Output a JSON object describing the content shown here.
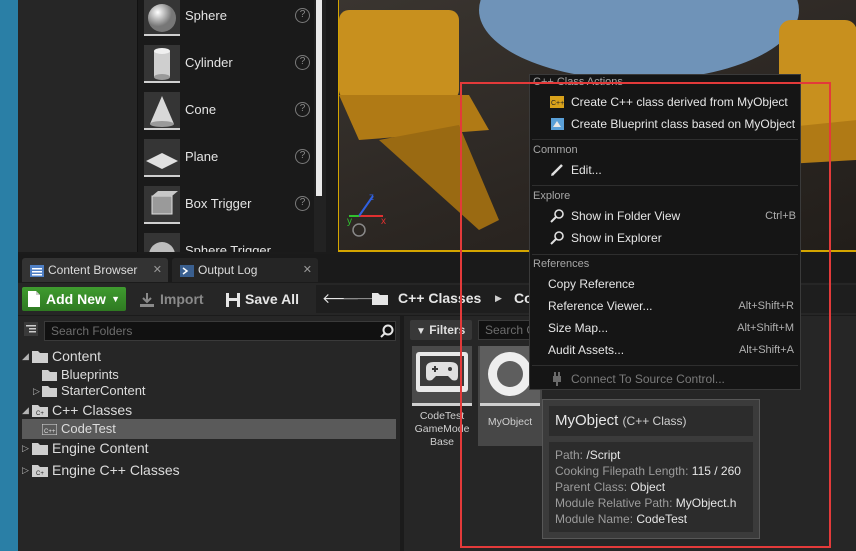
{
  "place_actors": {
    "items": [
      {
        "label": "Sphere",
        "icon": "sphere-icon"
      },
      {
        "label": "Cylinder",
        "icon": "cylinder-icon"
      },
      {
        "label": "Cone",
        "icon": "cone-icon"
      },
      {
        "label": "Plane",
        "icon": "plane-icon"
      },
      {
        "label": "Box Trigger",
        "icon": "box-trigger-icon"
      },
      {
        "label": "Sphere Trigger",
        "icon": "sphere-trigger-icon"
      }
    ],
    "help_glyph": "?"
  },
  "tabs": [
    {
      "label": "Content Browser",
      "close": "✕"
    },
    {
      "label": "Output Log",
      "close": "✕"
    }
  ],
  "toolbar": {
    "add_new": "Add New",
    "import": "Import",
    "save_all": "Save All",
    "breadcrumb": [
      "C++ Classes",
      "Co"
    ]
  },
  "tree": {
    "search_placeholder": "Search Folders",
    "items": [
      {
        "label": "Content"
      },
      {
        "label": "Blueprints"
      },
      {
        "label": "StarterContent"
      },
      {
        "label": "C++ Classes"
      },
      {
        "label": "CodeTest"
      },
      {
        "label": "Engine Content"
      },
      {
        "label": "Engine C++ Classes"
      }
    ]
  },
  "assets": {
    "filters_label": "Filters",
    "search_placeholder": "Search C",
    "tiles": [
      {
        "label": "CodeTest GameMode Base"
      },
      {
        "label": "MyObject"
      }
    ]
  },
  "context_menu": {
    "sections": [
      {
        "header": "C++ Class Actions",
        "items": [
          {
            "label": "Create C++ class derived from MyObject",
            "icon": "cpp-class-icon"
          },
          {
            "label": "Create Blueprint class based on MyObject",
            "icon": "blueprint-icon"
          }
        ]
      },
      {
        "header": "Common",
        "items": [
          {
            "label": "Edit...",
            "icon": "edit-icon"
          }
        ]
      },
      {
        "header": "Explore",
        "items": [
          {
            "label": "Show in Folder View",
            "shortcut": "Ctrl+B",
            "icon": "magnifier-icon"
          },
          {
            "label": "Show in Explorer",
            "icon": "magnifier-icon"
          }
        ]
      },
      {
        "header": "References",
        "items": [
          {
            "label": "Copy Reference"
          },
          {
            "label": "Reference Viewer...",
            "shortcut": "Alt+Shift+R"
          },
          {
            "label": "Size Map...",
            "shortcut": "Alt+Shift+M"
          },
          {
            "label": "Audit Assets...",
            "shortcut": "Alt+Shift+A"
          }
        ]
      },
      {
        "header": "",
        "items": [
          {
            "label": "Connect To Source Control...",
            "icon": "source-control-icon",
            "disabled": true
          }
        ]
      }
    ]
  },
  "tooltip": {
    "title": "MyObject",
    "subtitle": "(C++ Class)",
    "rows": [
      {
        "key": "Path:",
        "value": "/Script"
      },
      {
        "key": "Cooking Filepath Length:",
        "value": "115 / 260"
      },
      {
        "key": "Parent Class:",
        "value": "Object"
      },
      {
        "key": "Module Relative Path:",
        "value": "MyObject.h"
      },
      {
        "key": "Module Name:",
        "value": "CodeTest"
      }
    ]
  },
  "colors": {
    "add_new_green": "#3f9b2f",
    "highlight_red": "#e33a3a",
    "viewport_border": "#d4a500"
  }
}
